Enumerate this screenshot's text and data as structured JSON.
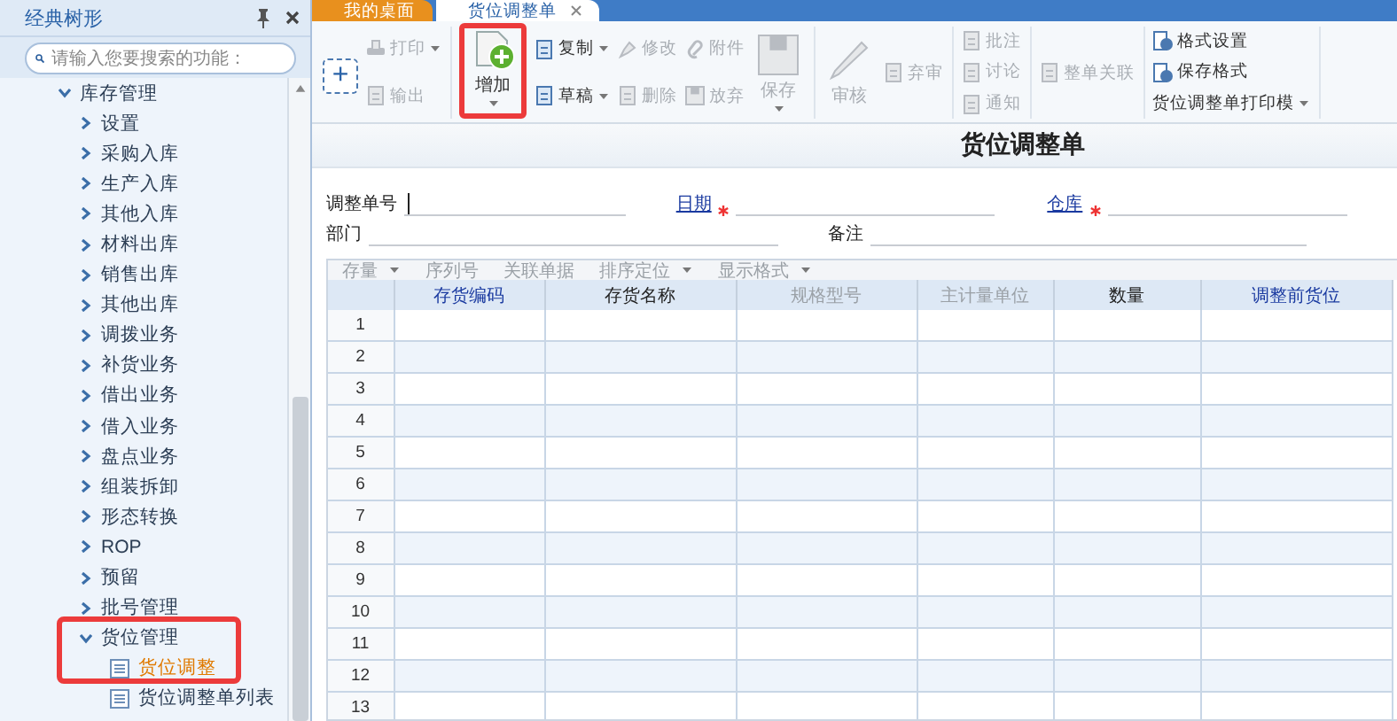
{
  "sidebar": {
    "title": "经典树形",
    "search": {
      "placeholder": "请输入您要搜索的功能："
    },
    "tree": [
      {
        "label": "库存管理",
        "kind": "folder",
        "expanded": true,
        "selected": false,
        "highlighted": false,
        "children": [
          {
            "label": "设置",
            "kind": "folder",
            "expanded": false,
            "selected": false,
            "highlighted": false
          },
          {
            "label": "采购入库",
            "kind": "folder",
            "expanded": false,
            "selected": false,
            "highlighted": false
          },
          {
            "label": "生产入库",
            "kind": "folder",
            "expanded": false,
            "selected": false,
            "highlighted": false
          },
          {
            "label": "其他入库",
            "kind": "folder",
            "expanded": false,
            "selected": false,
            "highlighted": false
          },
          {
            "label": "材料出库",
            "kind": "folder",
            "expanded": false,
            "selected": false,
            "highlighted": false
          },
          {
            "label": "销售出库",
            "kind": "folder",
            "expanded": false,
            "selected": false,
            "highlighted": false
          },
          {
            "label": "其他出库",
            "kind": "folder",
            "expanded": false,
            "selected": false,
            "highlighted": false
          },
          {
            "label": "调拨业务",
            "kind": "folder",
            "expanded": false,
            "selected": false,
            "highlighted": false
          },
          {
            "label": "补货业务",
            "kind": "folder",
            "expanded": false,
            "selected": false,
            "highlighted": false
          },
          {
            "label": "借出业务",
            "kind": "folder",
            "expanded": false,
            "selected": false,
            "highlighted": false
          },
          {
            "label": "借入业务",
            "kind": "folder",
            "expanded": false,
            "selected": false,
            "highlighted": false
          },
          {
            "label": "盘点业务",
            "kind": "folder",
            "expanded": false,
            "selected": false,
            "highlighted": false
          },
          {
            "label": "组装拆卸",
            "kind": "folder",
            "expanded": false,
            "selected": false,
            "highlighted": false
          },
          {
            "label": "形态转换",
            "kind": "folder",
            "expanded": false,
            "selected": false,
            "highlighted": false
          },
          {
            "label": "ROP",
            "kind": "folder",
            "expanded": false,
            "selected": false,
            "highlighted": false
          },
          {
            "label": "预留",
            "kind": "folder",
            "expanded": false,
            "selected": false,
            "highlighted": false
          },
          {
            "label": "批号管理",
            "kind": "folder",
            "expanded": false,
            "selected": false,
            "highlighted": false
          },
          {
            "label": "货位管理",
            "kind": "folder",
            "expanded": true,
            "selected": false,
            "highlighted": true,
            "children": [
              {
                "label": "货位调整",
                "kind": "leaf",
                "selected": true,
                "highlighted": false
              },
              {
                "label": "货位调整单列表",
                "kind": "leaf",
                "selected": false,
                "highlighted": false
              }
            ]
          }
        ]
      }
    ]
  },
  "tabs": [
    {
      "label": "我的桌面",
      "selected": false,
      "closable": false
    },
    {
      "label": "货位调整单",
      "selected": true,
      "closable": true
    }
  ],
  "toolbar": [
    {
      "columns": [
        {
          "kind": "stack",
          "items": [
            {
              "kind": "plus",
              "label": "+"
            }
          ]
        },
        {
          "kind": "stack",
          "items": [
            {
              "kind": "printer",
              "label": "打印",
              "dropdown": true,
              "disabled": true
            },
            {
              "kind": "document",
              "label": "输出",
              "dropdown": false,
              "disabled": true
            }
          ]
        }
      ]
    },
    {
      "columns": [
        {
          "kind": "large",
          "items": [
            {
              "kind": "add",
              "label": "增加",
              "dropdown": true,
              "disabled": false,
              "highlighted": true
            }
          ]
        },
        {
          "kind": "stack",
          "items": [
            {
              "kind": "document",
              "label": "复制",
              "dropdown": true,
              "disabled": false
            },
            {
              "kind": "document",
              "label": "草稿",
              "dropdown": true,
              "disabled": false
            }
          ]
        },
        {
          "kind": "stack",
          "items": [
            {
              "kind": "pencil",
              "label": "修改",
              "dropdown": false,
              "disabled": true
            },
            {
              "kind": "document",
              "label": "删除",
              "dropdown": false,
              "disabled": true
            }
          ]
        },
        {
          "kind": "stack",
          "items": [
            {
              "kind": "clip",
              "label": "附件",
              "dropdown": false,
              "disabled": true
            },
            {
              "kind": "disk",
              "label": "放弃",
              "dropdown": false,
              "disabled": true
            }
          ]
        },
        {
          "kind": "large",
          "items": [
            {
              "kind": "disk",
              "label": "保存",
              "dropdown": true,
              "disabled": true,
              "highlighted": false
            }
          ]
        }
      ]
    },
    {
      "columns": [
        {
          "kind": "large",
          "items": [
            {
              "kind": "pencil",
              "label": "审核",
              "dropdown": false,
              "disabled": true,
              "highlighted": false
            }
          ]
        },
        {
          "kind": "stack",
          "items": [
            {
              "kind": "document",
              "label": "弃审",
              "dropdown": false,
              "disabled": true
            }
          ]
        }
      ]
    },
    {
      "columns": [
        {
          "kind": "stack",
          "items": [
            {
              "kind": "document",
              "label": "批注",
              "dropdown": false,
              "disabled": true
            },
            {
              "kind": "document",
              "label": "讨论",
              "dropdown": false,
              "disabled": true
            },
            {
              "kind": "document",
              "label": "通知",
              "dropdown": false,
              "disabled": true
            }
          ]
        }
      ]
    },
    {
      "columns": [
        {
          "kind": "stack",
          "items": [
            {
              "kind": "document",
              "label": "整单关联",
              "dropdown": false,
              "disabled": true
            }
          ]
        }
      ]
    },
    {
      "columns": [
        {
          "kind": "stack",
          "items": [
            {
              "kind": "gear",
              "label": "格式设置",
              "dropdown": false,
              "disabled": false
            },
            {
              "kind": "gear",
              "label": "保存格式",
              "dropdown": false,
              "disabled": false
            },
            {
              "kind": "text",
              "label": "货位调整单打印模",
              "dropdown": true,
              "disabled": false
            }
          ]
        }
      ]
    }
  ],
  "form": {
    "title": "货位调整单",
    "rows": [
      [
        {
          "label": "调整单号",
          "kind": "plain",
          "required": false,
          "focused": true
        },
        {
          "label": "日期",
          "kind": "link",
          "required": true,
          "focused": false
        },
        {
          "label": "仓库",
          "kind": "link",
          "required": true,
          "focused": false
        }
      ],
      [
        {
          "label": "部门",
          "kind": "plain",
          "required": false,
          "focused": false
        },
        {
          "label": "备注",
          "kind": "plain",
          "required": false,
          "focused": false
        }
      ]
    ]
  },
  "grid_toolbar": [
    {
      "label": "存量",
      "dropdown": true
    },
    {
      "label": "序列号",
      "dropdown": false
    },
    {
      "label": "关联单据",
      "dropdown": false
    },
    {
      "label": "排序定位",
      "dropdown": true
    },
    {
      "label": "显示格式",
      "dropdown": true
    }
  ],
  "table": {
    "columns": [
      {
        "label": "存货编码",
        "kind": "link"
      },
      {
        "label": "存货名称",
        "kind": "plain"
      },
      {
        "label": "规格型号",
        "kind": "disabled"
      },
      {
        "label": "主计量单位",
        "kind": "disabled"
      },
      {
        "label": "数量",
        "kind": "plain"
      },
      {
        "label": "调整前货位",
        "kind": "link"
      }
    ],
    "row_numbers": [
      "1",
      "2",
      "3",
      "4",
      "5",
      "6",
      "7",
      "8",
      "9",
      "10",
      "11",
      "12",
      "13"
    ]
  }
}
